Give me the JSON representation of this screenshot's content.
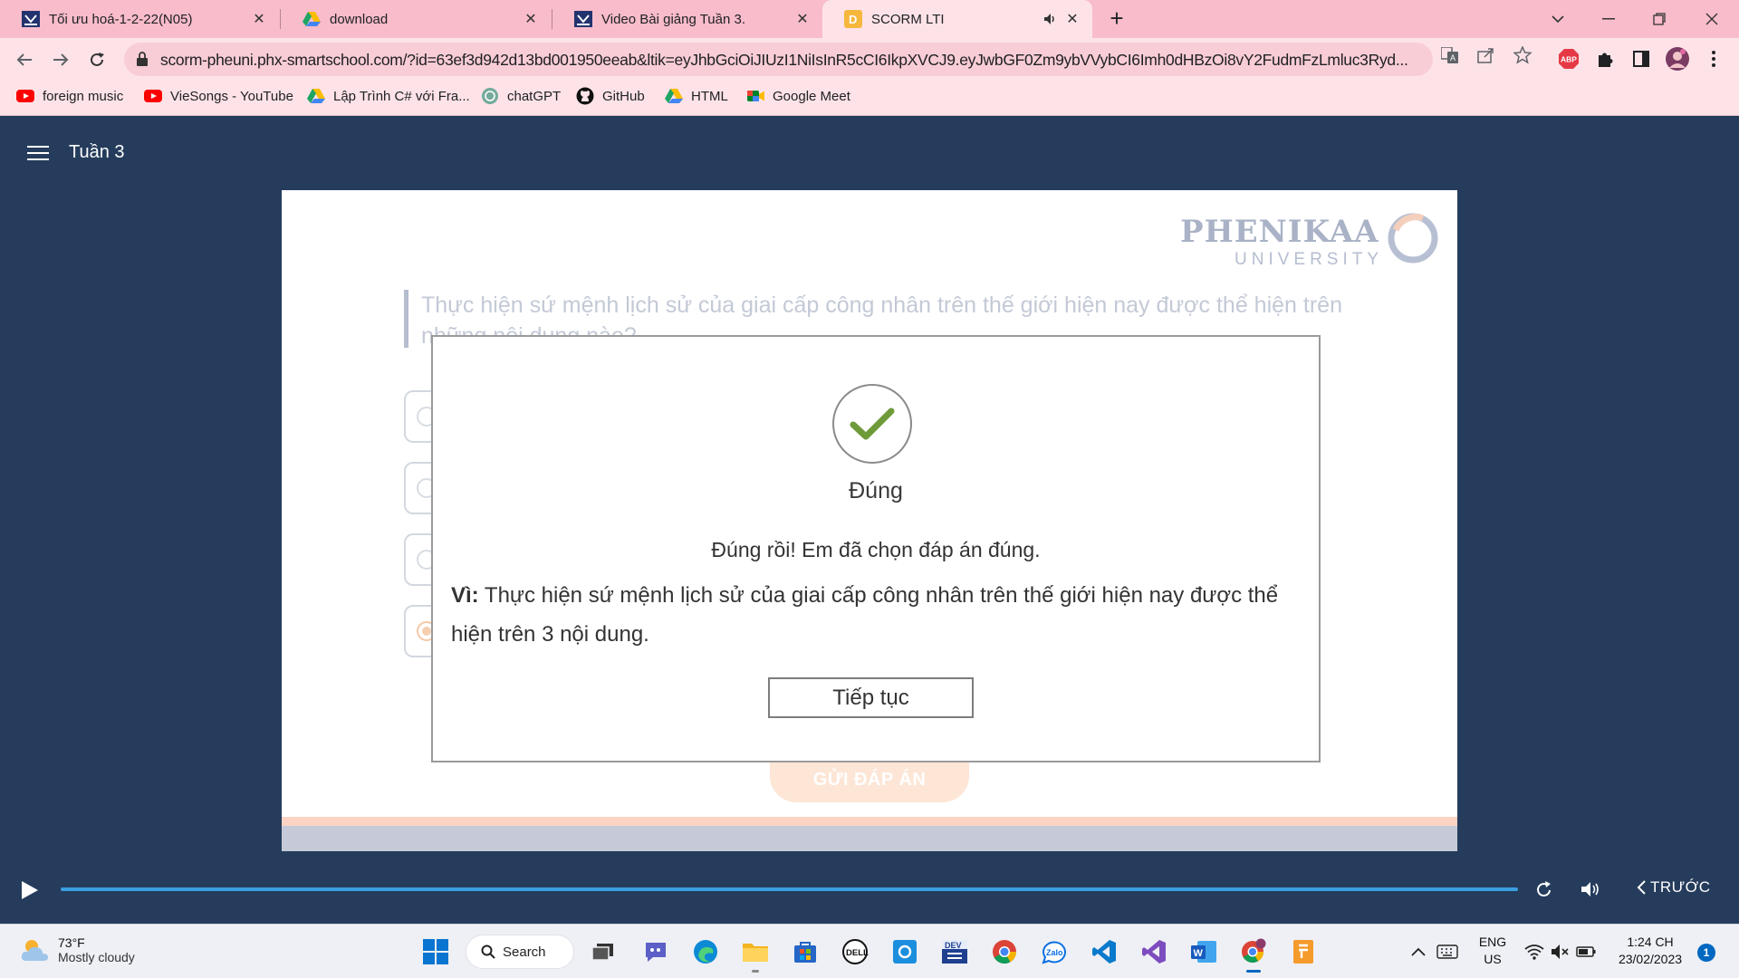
{
  "browser": {
    "tabs": [
      {
        "title": "Tối ưu hoá-1-2-22(N05)",
        "close": "✕"
      },
      {
        "title": "download",
        "close": "✕"
      },
      {
        "title": "Video Bài giảng Tuần 3.",
        "close": "✕"
      },
      {
        "title": "SCORM LTI",
        "close": "✕",
        "active": true
      }
    ],
    "new_tab": "+",
    "url": "scorm-pheuni.phx-smartschool.com/?id=63ef3d942d13bd001950eeab&ltik=eyJhbGciOiJIUzI1NiIsInR5cCI6IkpXVCJ9.eyJwbGF0Zm9ybVVybCI6Imh0dHBzOi8vY2FudmFzLmluc3Ryd...",
    "bookmarks": [
      {
        "label": "foreign music"
      },
      {
        "label": "VieSongs - YouTube"
      },
      {
        "label": "Lập Trình C# với Fra..."
      },
      {
        "label": "chatGPT"
      },
      {
        "label": "GitHub"
      },
      {
        "label": "HTML"
      },
      {
        "label": "Google Meet"
      }
    ],
    "abp_badge": "ABP"
  },
  "course": {
    "title": "Tuần 3"
  },
  "slide": {
    "logo_brand": "PHENIKAA",
    "logo_sub": "UNIVERSITY",
    "question": "Thực hiện sứ mệnh lịch sử của giai cấp công nhân trên thế giới hiện nay được thể hiện trên những nội dung nào?",
    "submit_label": "GỬI ĐÁP ÁN",
    "selected_option_index": 3
  },
  "feedback": {
    "verdict": "Đúng",
    "message": "Đúng rồi! Em đã chọn đáp án đúng.",
    "reason_label": "Vì:",
    "reason_text": " Thực hiện sứ mệnh lịch sử của giai cấp công nhân trên thế giới hiện nay được thể hiện trên 3 nội dung.",
    "continue_label": "Tiếp tục"
  },
  "player": {
    "prev_label": "TRƯỚC",
    "progress": 1.0
  },
  "taskbar": {
    "weather_temp": "73°F",
    "weather_desc": "Mostly cloudy",
    "search_label": "Search",
    "lang_top": "ENG",
    "lang_bottom": "US",
    "time": "1:24 CH",
    "date": "23/02/2023",
    "notification_count": "1",
    "dev_label": "DEV",
    "zalo_label": "Zalo"
  },
  "colors": {
    "tabstrip": "#f8bccb",
    "course_bg": "#253c5c",
    "check": "#6e9a3a",
    "seek": "#3b9ee0"
  }
}
